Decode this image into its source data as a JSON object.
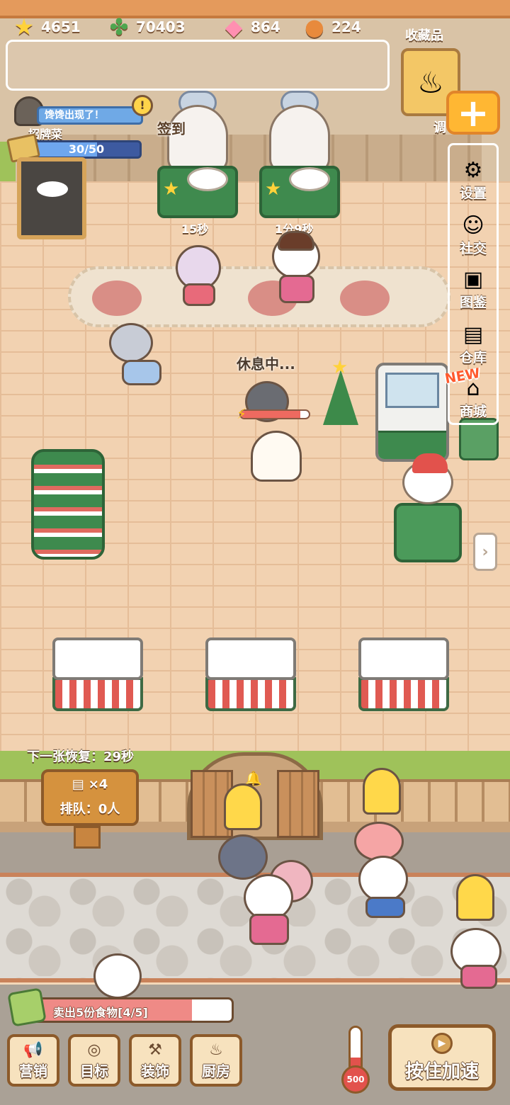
{
  "resources": [
    {
      "name": "star",
      "icon": "★",
      "value": "4651",
      "color": "#ffd23a"
    },
    {
      "name": "clover",
      "icon": "✤",
      "value": "70403",
      "color": "#4fa64f"
    },
    {
      "name": "candy",
      "icon": "◆",
      "value": "864",
      "color": "#ff8fb1"
    },
    {
      "name": "cookie",
      "icon": "●",
      "value": "224",
      "color": "#e88a3c"
    }
  ],
  "collectibles": {
    "label": "收藏品"
  },
  "stray_char": "调",
  "quest": {
    "banner": "馋馋出现了！",
    "excl": "!"
  },
  "signboard": {
    "label": "招牌菜",
    "progress_text": "30/50",
    "progress": 0.6
  },
  "checkin_label": "签到",
  "stations": [
    {
      "timer": "15秒"
    },
    {
      "timer": "1分9秒"
    }
  ],
  "side_menu": [
    {
      "label": "设置",
      "icon": "⚙"
    },
    {
      "label": "社交",
      "icon": "☺"
    },
    {
      "label": "图鉴",
      "icon": "▣"
    },
    {
      "label": "仓库",
      "icon": "▤"
    },
    {
      "label": "商城",
      "icon": "⌂"
    }
  ],
  "new_badge": "NEW",
  "worker_status": "休息中...",
  "energy_level": 0.88,
  "queue": {
    "next_recover": "下一张恢复：29秒",
    "tickets": "×4",
    "line": "排队：0人"
  },
  "task": {
    "text": "卖出5份食物[4/5]",
    "progress": 0.8
  },
  "bottom_nav": [
    {
      "label": "营销",
      "icon": "📢"
    },
    {
      "label": "目标",
      "icon": "◎"
    },
    {
      "label": "装饰",
      "icon": "⚒"
    },
    {
      "label": "厨房",
      "icon": "♨"
    }
  ],
  "thermometer": {
    "value": "500",
    "level": 0.35
  },
  "speed_button": {
    "label": "按住加速",
    "icon": "▶"
  }
}
